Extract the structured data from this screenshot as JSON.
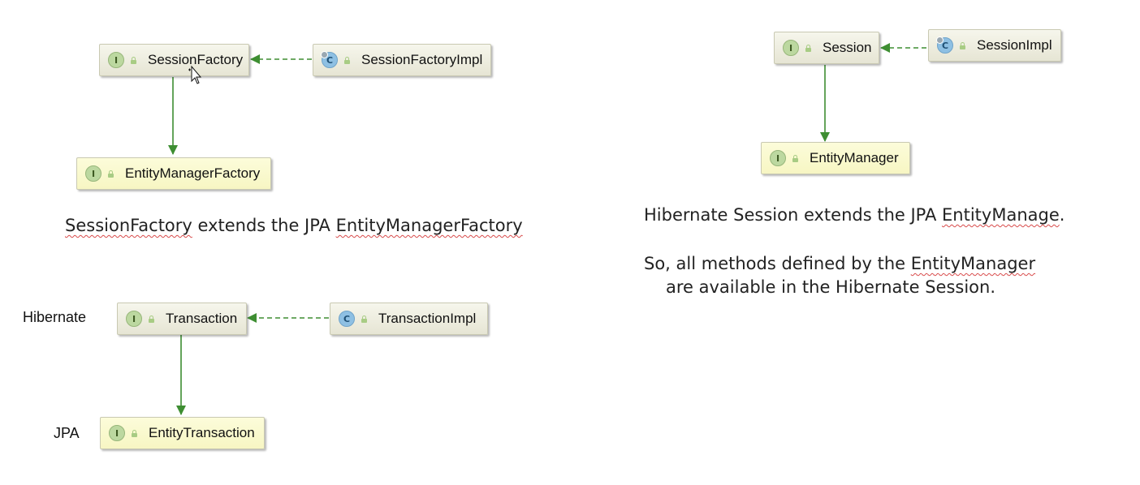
{
  "colors": {
    "inherits_arrow": "#3e8e32",
    "implements_arrow": "#3e8e32",
    "gray_node": "#ecebdb",
    "yellow_node": "#f9f8cc",
    "spellcheck": "#d84a4a"
  },
  "nodes": {
    "session_factory": {
      "kind": "I",
      "label": "SessionFactory"
    },
    "session_factory_impl": {
      "kind": "C",
      "label": "SessionFactoryImpl"
    },
    "entity_manager_factory": {
      "kind": "I",
      "label": "EntityManagerFactory"
    },
    "session": {
      "kind": "I",
      "label": "Session"
    },
    "session_impl": {
      "kind": "C",
      "label": "SessionImpl"
    },
    "entity_manager": {
      "kind": "I",
      "label": "EntityManager"
    },
    "transaction": {
      "kind": "I",
      "label": "Transaction"
    },
    "transaction_impl": {
      "kind": "C",
      "label": "TransactionImpl"
    },
    "entity_transaction": {
      "kind": "I",
      "label": "EntityTransaction"
    }
  },
  "edges": [
    {
      "from": "session_factory_impl",
      "to": "session_factory",
      "type": "implements"
    },
    {
      "from": "session_factory",
      "to": "entity_manager_factory",
      "type": "extends"
    },
    {
      "from": "session_impl",
      "to": "session",
      "type": "implements"
    },
    {
      "from": "session",
      "to": "entity_manager",
      "type": "extends"
    },
    {
      "from": "transaction_impl",
      "to": "transaction",
      "type": "implements"
    },
    {
      "from": "transaction",
      "to": "entity_transaction",
      "type": "extends"
    }
  ],
  "captions": {
    "factory": {
      "w1": "SessionFactory",
      "mid": " extends the JPA ",
      "w2": "EntityManagerFactory"
    },
    "session": {
      "pre": "Hibernate Session extends the JPA ",
      "w1": "EntityManage",
      "post": "."
    },
    "methods_line1": {
      "pre": "So, all methods defined by the ",
      "w1": "EntityManager"
    },
    "methods_line2": "are available in the Hibernate Session."
  },
  "side_labels": {
    "hibernate": "Hibernate",
    "jpa": "JPA"
  }
}
